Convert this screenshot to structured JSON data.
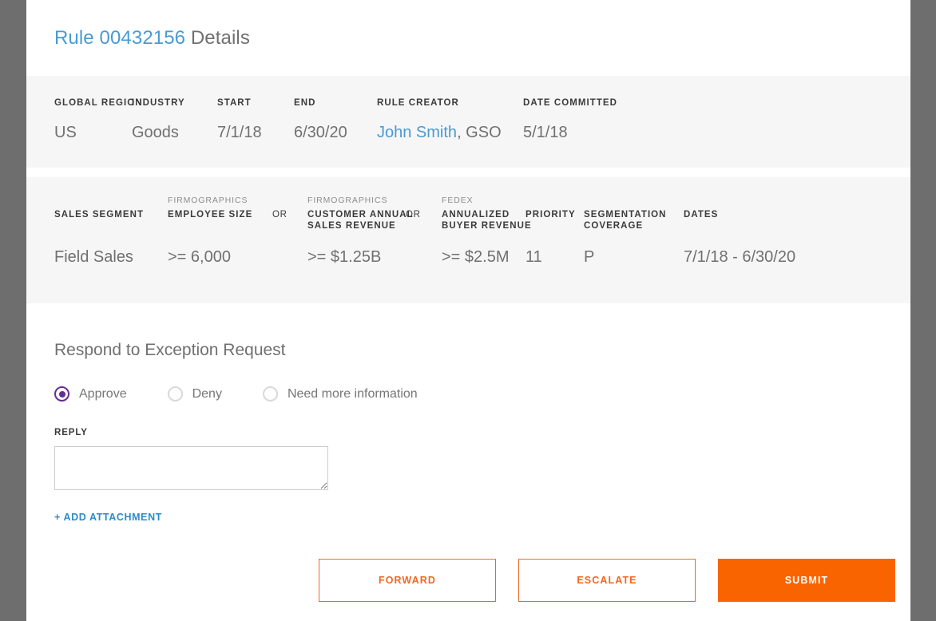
{
  "header": {
    "rule_id": "Rule 00432156",
    "title_suffix": " Details",
    "accent_blue": "#4a9ad4"
  },
  "meta": {
    "columns": [
      {
        "label": "GLOBAL REGION",
        "value": "US"
      },
      {
        "label": "INDUSTRY",
        "value": "Goods"
      },
      {
        "label": "START",
        "value": "7/1/18"
      },
      {
        "label": "END",
        "value": "6/30/20"
      },
      {
        "label": "RULE CREATOR",
        "value_link": "John Smith",
        "value_rest": ", GSO"
      },
      {
        "label": "DATE COMMITTED",
        "value": "5/1/18"
      }
    ]
  },
  "rule_table": {
    "columns": [
      {
        "sublabel": "",
        "label": "SALES SEGMENT",
        "value": "Field Sales"
      },
      {
        "sublabel": "FIRMOGRAPHICS",
        "label": "EMPLOYEE SIZE",
        "value": ">= 6,000"
      },
      {
        "sublabel": "",
        "label": "CUSTOMER ANNUAL SALES REVENUE",
        "value": ">= $1.25B",
        "sublabel2": "FIRMOGRAPHICS"
      },
      {
        "sublabel": "FEDEX",
        "label": "ANNUALIZED BUYER REVENUE",
        "value": ">= $2.5M"
      },
      {
        "sublabel": "",
        "label": "PRIORITY",
        "value": "11"
      },
      {
        "sublabel": "",
        "label": "SEGMENTATION COVERAGE",
        "value": "P"
      },
      {
        "sublabel": "",
        "label": "DATES",
        "value": "7/1/18 - 6/30/20"
      }
    ],
    "or_label_1": "OR",
    "or_label_2": "OR",
    "sub_firmographics": "FIRMOGRAPHICS",
    "sub_fedex": "FEDEX",
    "label_sales_segment": "SALES SEGMENT",
    "label_employee_size": "EMPLOYEE SIZE",
    "label_customer_annual_sales_revenue_l1": "CUSTOMER ANNUAL",
    "label_customer_annual_sales_revenue_l2": "SALES REVENUE",
    "label_annualized_buyer_revenue_l1": "ANNUALIZED",
    "label_annualized_buyer_revenue_l2": "BUYER REVENUE",
    "label_priority": "PRIORITY",
    "label_segmentation_coverage_l1": "SEGMENTATION",
    "label_segmentation_coverage_l2": "COVERAGE",
    "label_dates": "DATES",
    "value_sales_segment": "Field Sales",
    "value_employee_size": ">= 6,000",
    "value_customer_annual_sales_revenue": ">= $1.25B",
    "value_annualized_buyer_revenue": ">= $2.5M",
    "value_priority": "11",
    "value_segmentation_coverage": "P",
    "value_dates": "7/1/18 - 6/30/20"
  },
  "respond": {
    "section_title": "Respond to Exception Request",
    "options": [
      {
        "label": "Approve",
        "selected": true
      },
      {
        "label": "Deny",
        "selected": false
      },
      {
        "label": "Need more information",
        "selected": false
      }
    ],
    "option_approve": "Approve",
    "option_deny": "Deny",
    "option_more_info": "Need more information",
    "reply_label": "REPLY",
    "reply_value": "",
    "reply_placeholder": "",
    "add_attachment": "+ ADD ATTACHMENT",
    "selected_color": "#662d91"
  },
  "actions": {
    "forward": "FORWARD",
    "escalate": "ESCALATE",
    "submit": "SUBMIT",
    "outline_color": "#f26722",
    "solid_color": "#fa6400"
  }
}
